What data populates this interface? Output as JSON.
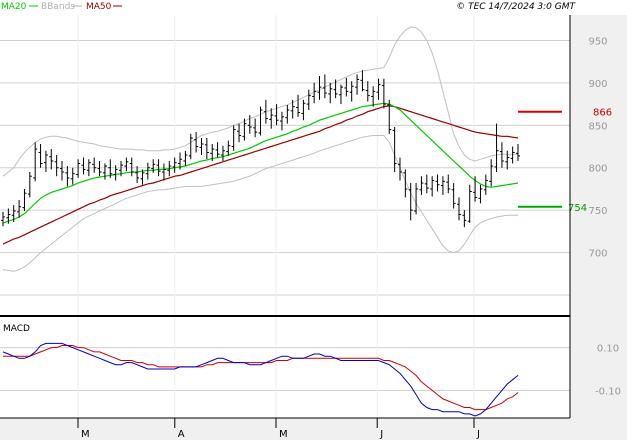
{
  "header": {
    "ma20_label": "MA20",
    "bbands_label": "BBands",
    "ma50_label": "MA50",
    "copyright": "© TEC 14/7/2024 3:0 GMT"
  },
  "colors": {
    "ma20": "#00cc00",
    "ma50": "#990000",
    "bbands": "#c0c0c0",
    "candle": "#000000",
    "macd": "#0000cc",
    "signal": "#cc0000",
    "grid": "#d0d0d0",
    "panel_bg": "#f0f0f0"
  },
  "chart_data": [
    {
      "type": "line",
      "panel": "price",
      "ylim": [
        630,
        980
      ],
      "y_ticks": [
        "950",
        "900",
        "850",
        "800",
        "750",
        "700"
      ],
      "x_ticks": [
        "M",
        "A",
        "M",
        "J",
        "J"
      ],
      "resistance": {
        "label": "866",
        "value": 866
      },
      "support": {
        "label": "754",
        "value": 754
      },
      "ohlc": [
        [
          738,
          748,
          731,
          742
        ],
        [
          741,
          752,
          734,
          745
        ],
        [
          744,
          756,
          736,
          749
        ],
        [
          748,
          762,
          741,
          754
        ],
        [
          753,
          775,
          749,
          770
        ],
        [
          769,
          795,
          765,
          790
        ],
        [
          788,
          830,
          784,
          822
        ],
        [
          818,
          828,
          800,
          805
        ],
        [
          806,
          820,
          795,
          815
        ],
        [
          813,
          822,
          798,
          808
        ],
        [
          807,
          815,
          790,
          800
        ],
        [
          799,
          808,
          785,
          795
        ],
        [
          794,
          802,
          778,
          788
        ],
        [
          787,
          800,
          780,
          793
        ],
        [
          792,
          810,
          788,
          805
        ],
        [
          803,
          812,
          792,
          798
        ],
        [
          797,
          810,
          790,
          806
        ],
        [
          804,
          812,
          794,
          800
        ],
        [
          799,
          808,
          790,
          795
        ],
        [
          794,
          805,
          786,
          802
        ],
        [
          800,
          810,
          788,
          793
        ],
        [
          792,
          803,
          785,
          798
        ],
        [
          797,
          808,
          790,
          803
        ],
        [
          802,
          812,
          796,
          807
        ],
        [
          805,
          812,
          790,
          795
        ],
        [
          794,
          802,
          782,
          788
        ],
        [
          787,
          798,
          780,
          794
        ],
        [
          793,
          806,
          786,
          800
        ],
        [
          799,
          810,
          794,
          804
        ],
        [
          803,
          810,
          790,
          796
        ],
        [
          795,
          805,
          785,
          798
        ],
        [
          797,
          808,
          790,
          802
        ],
        [
          801,
          812,
          794,
          806
        ],
        [
          805,
          818,
          798,
          810
        ],
        [
          808,
          820,
          802,
          815
        ],
        [
          814,
          840,
          810,
          835
        ],
        [
          833,
          842,
          818,
          825
        ],
        [
          824,
          835,
          815,
          828
        ],
        [
          827,
          835,
          810,
          818
        ],
        [
          817,
          828,
          808,
          822
        ],
        [
          821,
          830,
          812,
          816
        ],
        [
          815,
          826,
          808,
          820
        ],
        [
          819,
          832,
          814,
          826
        ],
        [
          825,
          850,
          820,
          845
        ],
        [
          843,
          852,
          830,
          838
        ],
        [
          837,
          858,
          832,
          852
        ],
        [
          850,
          862,
          840,
          848
        ],
        [
          847,
          858,
          836,
          842
        ],
        [
          841,
          872,
          838,
          868
        ],
        [
          866,
          880,
          852,
          858
        ],
        [
          857,
          870,
          846,
          862
        ],
        [
          861,
          875,
          850,
          856
        ],
        [
          855,
          866,
          844,
          860
        ],
        [
          859,
          874,
          852,
          868
        ],
        [
          867,
          880,
          858,
          872
        ],
        [
          871,
          886,
          860,
          865
        ],
        [
          864,
          880,
          856,
          876
        ],
        [
          875,
          892,
          868,
          885
        ],
        [
          884,
          900,
          876,
          890
        ],
        [
          889,
          908,
          880,
          895
        ],
        [
          894,
          910,
          882,
          888
        ],
        [
          887,
          900,
          876,
          893
        ],
        [
          892,
          904,
          882,
          887
        ],
        [
          886,
          898,
          875,
          895
        ],
        [
          894,
          906,
          884,
          890
        ],
        [
          889,
          902,
          878,
          896
        ],
        [
          895,
          910,
          886,
          904
        ],
        [
          903,
          915,
          890,
          892
        ],
        [
          891,
          902,
          878,
          885
        ],
        [
          884,
          896,
          872,
          890
        ],
        [
          889,
          905,
          880,
          898
        ],
        [
          897,
          905,
          870,
          875
        ],
        [
          874,
          880,
          840,
          845
        ],
        [
          844,
          848,
          795,
          805
        ],
        [
          804,
          812,
          785,
          795
        ],
        [
          794,
          798,
          765,
          775
        ],
        [
          774,
          782,
          738,
          750
        ],
        [
          749,
          782,
          745,
          775
        ],
        [
          774,
          790,
          768,
          782
        ],
        [
          781,
          792,
          770,
          776
        ],
        [
          775,
          790,
          766,
          785
        ],
        [
          784,
          792,
          772,
          780
        ],
        [
          779,
          790,
          768,
          784
        ],
        [
          783,
          792,
          770,
          775
        ],
        [
          774,
          782,
          752,
          758
        ],
        [
          757,
          765,
          738,
          745
        ],
        [
          744,
          750,
          730,
          738
        ],
        [
          737,
          780,
          735,
          772
        ],
        [
          771,
          790,
          760,
          765
        ],
        [
          764,
          780,
          758,
          775
        ],
        [
          774,
          792,
          768,
          785
        ],
        [
          784,
          810,
          778,
          802
        ],
        [
          801,
          852,
          795,
          820
        ],
        [
          819,
          830,
          800,
          808
        ],
        [
          807,
          820,
          798,
          812
        ],
        [
          811,
          825,
          805,
          818
        ],
        [
          817,
          828,
          808,
          814
        ]
      ],
      "ma20": [
        735,
        737,
        739,
        742,
        746,
        752,
        758,
        764,
        768,
        771,
        773,
        775,
        777,
        779,
        782,
        784,
        786,
        788,
        789,
        790,
        791,
        792,
        793,
        794,
        795,
        795,
        796,
        797,
        797,
        798,
        798,
        799,
        800,
        801,
        802,
        804,
        806,
        808,
        809,
        811,
        812,
        813,
        815,
        817,
        819,
        821,
        823,
        826,
        829,
        832,
        834,
        836,
        838,
        840,
        843,
        845,
        848,
        850,
        853,
        856,
        858,
        860,
        862,
        864,
        866,
        868,
        870,
        872,
        873,
        874,
        875,
        876,
        875,
        872,
        868,
        862,
        856,
        850,
        844,
        838,
        832,
        826,
        820,
        814,
        808,
        802,
        796,
        790,
        785,
        781,
        778,
        777,
        778,
        779,
        780,
        781,
        782
      ],
      "ma50": [
        710,
        713,
        716,
        718,
        721,
        724,
        727,
        730,
        733,
        736,
        739,
        742,
        745,
        748,
        751,
        754,
        757,
        759,
        762,
        764,
        767,
        769,
        771,
        773,
        775,
        777,
        779,
        781,
        782,
        784,
        786,
        788,
        790,
        791,
        793,
        795,
        797,
        799,
        801,
        803,
        805,
        807,
        809,
        811,
        813,
        815,
        817,
        819,
        821,
        823,
        825,
        827,
        829,
        831,
        833,
        835,
        837,
        839,
        841,
        843,
        846,
        848,
        851,
        853,
        856,
        858,
        861,
        863,
        866,
        868,
        870,
        872,
        873,
        872,
        870,
        868,
        866,
        864,
        862,
        860,
        858,
        856,
        854,
        852,
        850,
        848,
        846,
        844,
        842,
        841,
        840,
        839,
        838,
        837,
        837,
        836,
        835
      ],
      "bb_upper": [
        790,
        795,
        800,
        810,
        818,
        824,
        830,
        834,
        836,
        837,
        837,
        836,
        835,
        833,
        831,
        830,
        829,
        828,
        826,
        825,
        824,
        823,
        822,
        822,
        822,
        821,
        821,
        820,
        820,
        820,
        821,
        821,
        822,
        824,
        826,
        830,
        834,
        838,
        840,
        842,
        843,
        845,
        847,
        850,
        852,
        855,
        858,
        860,
        863,
        866,
        868,
        870,
        872,
        874,
        877,
        880,
        883,
        886,
        889,
        892,
        895,
        898,
        901,
        904,
        907,
        910,
        912,
        914,
        915,
        916,
        917,
        918,
        930,
        945,
        955,
        962,
        966,
        965,
        960,
        950,
        935,
        915,
        890,
        865,
        840,
        825,
        815,
        810,
        808,
        810,
        812,
        814,
        815,
        816,
        816,
        816,
        816
      ],
      "bb_lower": [
        680,
        679,
        678,
        680,
        683,
        688,
        694,
        700,
        705,
        710,
        715,
        720,
        725,
        730,
        735,
        740,
        743,
        746,
        749,
        752,
        755,
        758,
        761,
        764,
        766,
        768,
        770,
        772,
        773,
        774,
        774,
        775,
        776,
        777,
        778,
        778,
        778,
        778,
        779,
        780,
        781,
        782,
        783,
        784,
        786,
        788,
        790,
        793,
        796,
        799,
        801,
        803,
        805,
        807,
        809,
        811,
        813,
        815,
        817,
        820,
        822,
        824,
        826,
        828,
        830,
        832,
        834,
        836,
        837,
        838,
        838,
        838,
        830,
        815,
        800,
        785,
        770,
        758,
        748,
        738,
        728,
        718,
        708,
        702,
        700,
        702,
        710,
        720,
        730,
        735,
        738,
        740,
        742,
        743,
        744,
        744,
        744
      ]
    },
    {
      "type": "line",
      "panel": "macd",
      "title": "MACD",
      "ylim": [
        -22,
        22
      ],
      "y_ticks": [
        "0.10",
        "-0.10"
      ],
      "series": [
        {
          "values": [
            8,
            7,
            6,
            5,
            5,
            6,
            8,
            11,
            12,
            12,
            12,
            12,
            11,
            10,
            9,
            8,
            7,
            6,
            5,
            4,
            3,
            2,
            2,
            3,
            3,
            2,
            1,
            0,
            0,
            0,
            0,
            0,
            0,
            1,
            1,
            1,
            1,
            2,
            3,
            4,
            5,
            5,
            4,
            3,
            3,
            3,
            2,
            2,
            2,
            3,
            4,
            5,
            6,
            6,
            5,
            5,
            5,
            6,
            7,
            7,
            6,
            6,
            5,
            4,
            4,
            4,
            4,
            4,
            4,
            4,
            4,
            3,
            2,
            0,
            -2,
            -5,
            -8,
            -12,
            -16,
            -18,
            -19,
            -19,
            -20,
            -20,
            -20,
            -20,
            -21,
            -21,
            -22,
            -21,
            -19,
            -16,
            -13,
            -10,
            -7,
            -5,
            -3
          ]
        },
        {
          "values": [
            6,
            6,
            6,
            6,
            6,
            6,
            7,
            8,
            9,
            10,
            10,
            11,
            11,
            11,
            10,
            10,
            9,
            8,
            8,
            7,
            6,
            5,
            4,
            4,
            4,
            3,
            3,
            2,
            2,
            1,
            1,
            1,
            1,
            1,
            1,
            1,
            1,
            1,
            2,
            2,
            3,
            3,
            3,
            3,
            3,
            3,
            3,
            3,
            3,
            3,
            3,
            4,
            4,
            4,
            5,
            5,
            5,
            5,
            5,
            5,
            5,
            5,
            5,
            5,
            5,
            5,
            5,
            5,
            5,
            5,
            5,
            4,
            4,
            3,
            2,
            1,
            -1,
            -3,
            -6,
            -8,
            -10,
            -12,
            -14,
            -15,
            -16,
            -17,
            -18,
            -18,
            -19,
            -19,
            -19,
            -18,
            -17,
            -16,
            -14,
            -13,
            -11
          ]
        }
      ]
    }
  ]
}
